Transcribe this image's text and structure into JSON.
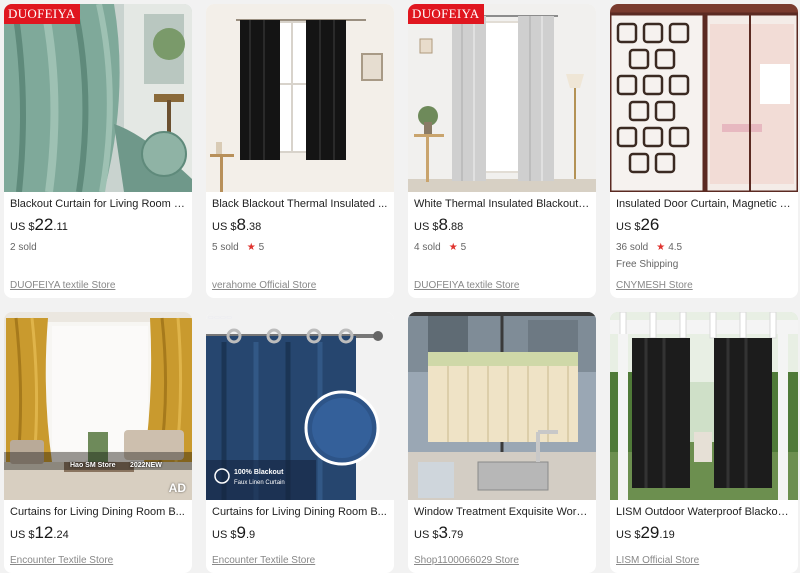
{
  "products": [
    {
      "title": "Blackout Curtain for Living Room B...",
      "currency": "US $",
      "price_main": "22",
      "price_cents": ".11",
      "sold": "2 sold",
      "rating": "",
      "shipping": "",
      "store": "DUOFEIYA textile Store",
      "badge": "DUOFEIYA",
      "image_icon": "sage-green-curtain-image"
    },
    {
      "title": "Black Blackout Thermal Insulated ...",
      "currency": "US $",
      "price_main": "8",
      "price_cents": ".38",
      "sold": "5 sold",
      "rating": "5",
      "shipping": "",
      "store": "verahome Official Store",
      "badge": "",
      "image_icon": "black-curtain-window-image"
    },
    {
      "title": "White Thermal Insulated Blackout ...",
      "currency": "US $",
      "price_main": "8",
      "price_cents": ".88",
      "sold": "4 sold",
      "rating": "5",
      "shipping": "",
      "store": "DUOFEIYA textile Store",
      "badge": "DUOFEIYA",
      "image_icon": "white-curtain-room-image"
    },
    {
      "title": "Insulated Door Curtain, Magnetic T...",
      "currency": "US $",
      "price_main": "26",
      "price_cents": "",
      "sold": "36 sold",
      "rating": "4.5",
      "shipping": "Free Shipping",
      "store": "CNYMESH Store",
      "badge": "",
      "image_icon": "magnetic-door-curtain-image"
    },
    {
      "title": "Curtains for Living Dining Room B...",
      "currency": "US $",
      "price_main": "12",
      "price_cents": ".24",
      "sold": "",
      "rating": "",
      "shipping": "",
      "store": "Encounter Textile Store",
      "badge": "",
      "ad": "AD",
      "overlay_store": "Hao SM Store",
      "overlay_year": "2022NEW",
      "image_icon": "gold-curtain-living-room-image"
    },
    {
      "title": "Curtains for Living Dining Room B...",
      "currency": "US $",
      "price_main": "9",
      "price_cents": ".9",
      "sold": "",
      "rating": "",
      "shipping": "",
      "store": "Encounter Textile Store",
      "badge": "",
      "overlay_line1": "100% Blackout",
      "overlay_line2": "Faux Linen Curtain",
      "image_icon": "navy-linen-curtain-image"
    },
    {
      "title": "Window Treatment Exquisite Work...",
      "currency": "US $",
      "price_main": "3",
      "price_cents": ".79",
      "sold": "",
      "rating": "",
      "shipping": "",
      "store": "Shop1100066029 Store",
      "badge": "",
      "image_icon": "kitchen-cafe-curtain-image"
    },
    {
      "title": "LISM Outdoor Waterproof Blackou...",
      "currency": "US $",
      "price_main": "29",
      "price_cents": ".19",
      "sold": "",
      "rating": "",
      "shipping": "",
      "store": "LISM Official Store",
      "badge": "",
      "image_icon": "outdoor-pergola-curtain-image"
    }
  ],
  "colors": {
    "price": "#191919",
    "star": "#e0332e",
    "badge": "#e0161f",
    "store_link": "#888888"
  }
}
